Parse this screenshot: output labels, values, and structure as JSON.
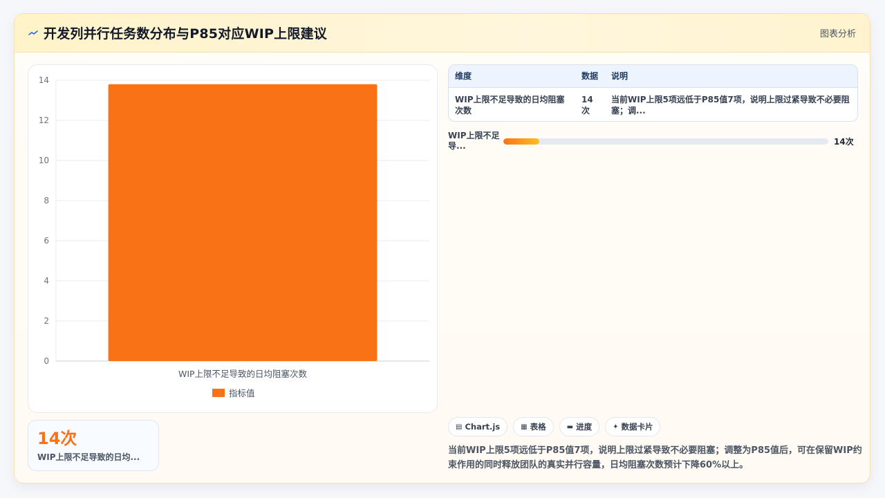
{
  "header": {
    "title": "开发列并行任务数分布与P85对应WIP上限建议",
    "right_label": "图表分析",
    "accent_color": "#2563eb"
  },
  "chart_data": {
    "type": "bar",
    "categories": [
      "WIP上限不足导致的日均阻塞次数"
    ],
    "series": [
      {
        "name": "指标值",
        "values": [
          13.8
        ],
        "color": "#f97316"
      }
    ],
    "ylim": [
      0,
      14
    ],
    "yticks": [
      "0",
      "2",
      "4",
      "6",
      "8",
      "10",
      "12",
      "14"
    ],
    "grid": true,
    "legend": "bottom"
  },
  "kpi": {
    "value": "14次",
    "label": "WIP上限不足导致的日均..."
  },
  "table": {
    "headers": [
      "维度",
      "数据",
      "说明"
    ],
    "rows": [
      [
        "WIP上限不足导致的日均阻塞次数",
        "14次",
        "当前WIP上限5项远低于P85值7项，说明上限过紧导致不必要阻塞；调..."
      ]
    ]
  },
  "progress": {
    "label": "WIP上限不足导...",
    "value_label": "14次",
    "fraction": 0.11
  },
  "chips": [
    {
      "icon": "chart-icon",
      "glyph": "▤",
      "label": "Chart.js"
    },
    {
      "icon": "table-icon",
      "glyph": "▦",
      "label": "表格"
    },
    {
      "icon": "progress-icon",
      "glyph": "▬",
      "label": "进度"
    },
    {
      "icon": "sparkle-icon",
      "glyph": "✦",
      "label": "数据卡片"
    }
  ],
  "summary": "当前WIP上限5项远低于P85值7项，说明上限过紧导致不必要阻塞；调整为P85值后，可在保留WIP约束作用的同时释放团队的真实并行容量，日均阻塞次数预计下降60%以上。"
}
